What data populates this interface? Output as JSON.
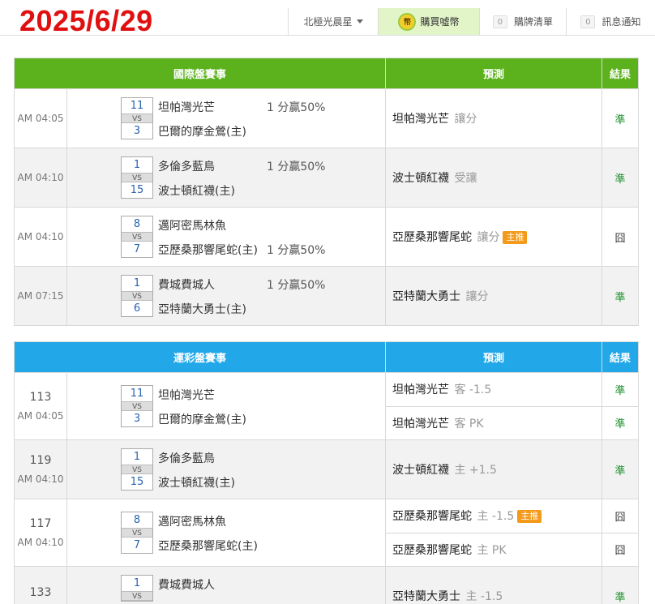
{
  "date": "2025/6/29",
  "nav": {
    "user": "北極光晨星",
    "buy_icon": "幣",
    "buy": "購買噓幣",
    "cart_count": "0",
    "cart": "購牌清單",
    "msg_count": "0",
    "msg": "訊息通知"
  },
  "intl": {
    "header": {
      "event": "國際盤賽事",
      "predict": "預測",
      "result": "結果"
    },
    "rows": [
      {
        "time": "AM 04:05",
        "s1": "11",
        "s2": "3",
        "vs": "VS",
        "t1": "坦帕灣光芒",
        "t2": "巴爾的摩金鶯(主)",
        "odds": "1 分贏50%",
        "pick": "坦帕灣光芒",
        "type": "讓分",
        "badge": "",
        "result": "準"
      },
      {
        "time": "AM 04:10",
        "s1": "1",
        "s2": "15",
        "vs": "VS",
        "t1": "多倫多藍鳥",
        "t2": "波士頓紅襪(主)",
        "odds": "1 分贏50%",
        "pick": "波士頓紅襪",
        "type": "受讓",
        "badge": "",
        "result": "準"
      },
      {
        "time": "AM 04:10",
        "s1": "8",
        "s2": "7",
        "vs": "VS",
        "t1": "邁阿密馬林魚",
        "t2": "亞歷桑那響尾蛇(主)",
        "odds": "1 分贏50%",
        "pick": "亞歷桑那響尾蛇",
        "type": "讓分",
        "badge": "主推",
        "result": "囧"
      },
      {
        "time": "AM 07:15",
        "s1": "1",
        "s2": "6",
        "vs": "VS",
        "t1": "費城費城人",
        "t2": "亞特蘭大勇士(主)",
        "odds": "1 分贏50%",
        "pick": "亞特蘭大勇士",
        "type": "讓分",
        "badge": "",
        "result": "準"
      }
    ]
  },
  "lottery": {
    "header": {
      "event": "運彩盤賽事",
      "predict": "預測",
      "result": "結果"
    },
    "rows": [
      {
        "num": "113",
        "time": "AM 04:05",
        "s1": "11",
        "s2": "3",
        "vs": "VS",
        "t1": "坦帕灣光芒",
        "t2": "巴爾的摩金鶯(主)",
        "picks": [
          {
            "team": "坦帕灣光芒",
            "line": "客 -1.5",
            "badge": "",
            "result": "準"
          },
          {
            "team": "坦帕灣光芒",
            "line": "客 PK",
            "badge": "",
            "result": "準"
          }
        ]
      },
      {
        "num": "119",
        "time": "AM 04:10",
        "s1": "1",
        "s2": "15",
        "vs": "VS",
        "t1": "多倫多藍鳥",
        "t2": "波士頓紅襪(主)",
        "picks": [
          {
            "team": "波士頓紅襪",
            "line": "主 +1.5",
            "badge": "",
            "result": "準"
          }
        ]
      },
      {
        "num": "117",
        "time": "AM 04:10",
        "s1": "8",
        "s2": "7",
        "vs": "VS",
        "t1": "邁阿密馬林魚",
        "t2": "亞歷桑那響尾蛇(主)",
        "picks": [
          {
            "team": "亞歷桑那響尾蛇",
            "line": "主 -1.5",
            "badge": "主推",
            "result": "囧"
          },
          {
            "team": "亞歷桑那響尾蛇",
            "line": "主 PK",
            "badge": "",
            "result": "囧"
          }
        ]
      },
      {
        "num": "133",
        "s1": "1",
        "vs": "VS",
        "t1": "費城費城人",
        "picks": [
          {
            "team": "亞特蘭大勇士",
            "line": "主 -1.5",
            "badge": "",
            "result": "準"
          }
        ]
      }
    ]
  }
}
